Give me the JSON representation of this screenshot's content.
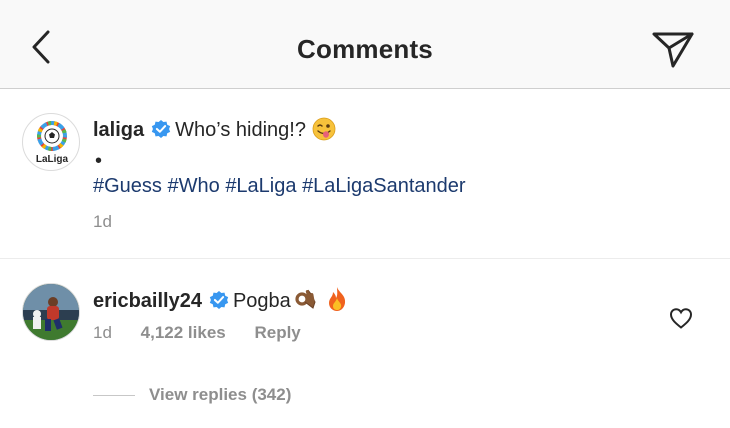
{
  "header": {
    "title": "Comments",
    "back_icon": "chevron-left-icon",
    "share_icon": "paper-plane-icon"
  },
  "caption": {
    "username": "laliga",
    "verified": true,
    "text": "Who’s hiding!?",
    "emoji": "winking-face-with-tongue",
    "bullet": "•",
    "hashtags": [
      "#Guess",
      "#Who",
      "#LaLiga",
      "#LaLigaSantander"
    ],
    "time": "1d",
    "avatar_label": "LaLiga"
  },
  "comments": [
    {
      "username": "ericbailly24",
      "verified": true,
      "text": "Pogba",
      "emojis": [
        "ok-hand-medium-dark",
        "fire"
      ],
      "time": "1d",
      "likes": "4,122 likes",
      "reply_label": "Reply",
      "view_replies": "View replies (342)"
    }
  ],
  "colors": {
    "hashtag": "#1c3a6e",
    "verified": "#3897f0",
    "muted": "#8e8e8e",
    "text": "#262626",
    "header_bg": "#f9f9f9"
  }
}
